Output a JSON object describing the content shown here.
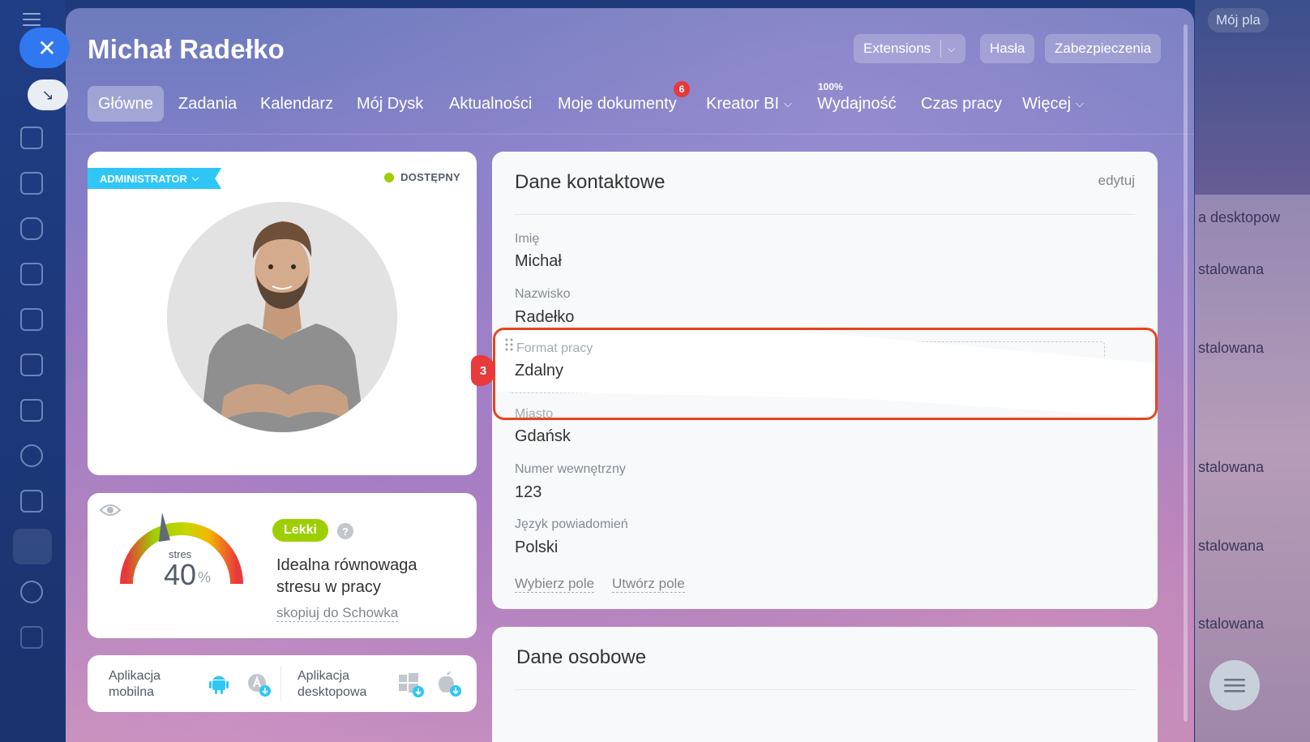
{
  "app": {
    "title": "Michał Radełko",
    "buttons": {
      "extensions": "Extensions",
      "passwords": "Hasła",
      "security": "Zabezpieczenia"
    }
  },
  "tabs": [
    {
      "label": "Główne",
      "active": true
    },
    {
      "label": "Zadania"
    },
    {
      "label": "Kalendarz"
    },
    {
      "label": "Mój Dysk"
    },
    {
      "label": "Aktualności"
    },
    {
      "label": "Moje dokumenty",
      "badge": "6"
    },
    {
      "label": "Kreator BI",
      "dropdown": true
    },
    {
      "label": "Wydajność",
      "top_note": "100%"
    },
    {
      "label": "Czas pracy"
    },
    {
      "label": "Więcej",
      "dropdown": true
    }
  ],
  "profile": {
    "role": "ADMINISTRATOR",
    "status": "DOSTĘPNY",
    "status_color": "#9dcf00"
  },
  "stress": {
    "label": "stres",
    "value": "40",
    "unit": "%",
    "level": "Lekki",
    "help": "?",
    "description": "Idealna równowaga stresu w pracy",
    "copy_link": "skopiuj do Schowka"
  },
  "apps": {
    "mobile": "Aplikacja mobilna",
    "desktop": "Aplikacja desktopowa"
  },
  "contact": {
    "title": "Dane kontaktowe",
    "edit": "edytuj",
    "fields": [
      {
        "label": "Imię",
        "value": "Michał"
      },
      {
        "label": "Nazwisko",
        "value": "Radełko"
      },
      {
        "label": "Format pracy",
        "value": "Zdalny"
      },
      {
        "label": "Miasto",
        "value": "Gdańsk"
      },
      {
        "label": "Numer wewnętrzny",
        "value": "123"
      },
      {
        "label": "Język powiadomień",
        "value": "Polski"
      }
    ],
    "choose_field": "Wybierz pole",
    "create_field": "Utwórz pole",
    "step_badge": "3"
  },
  "personal": {
    "title": "Dane osobowe"
  },
  "background": {
    "top_button": "Mój pla",
    "items": [
      "a desktopow",
      "stalowana",
      "stalowana",
      "stalowana",
      "stalowana",
      "stalowana"
    ]
  },
  "colors": {
    "accent": "#2f78f0",
    "admin_badge": "#2fc6f6",
    "badge_red": "#e8393b",
    "highlight": "#e8441e"
  }
}
